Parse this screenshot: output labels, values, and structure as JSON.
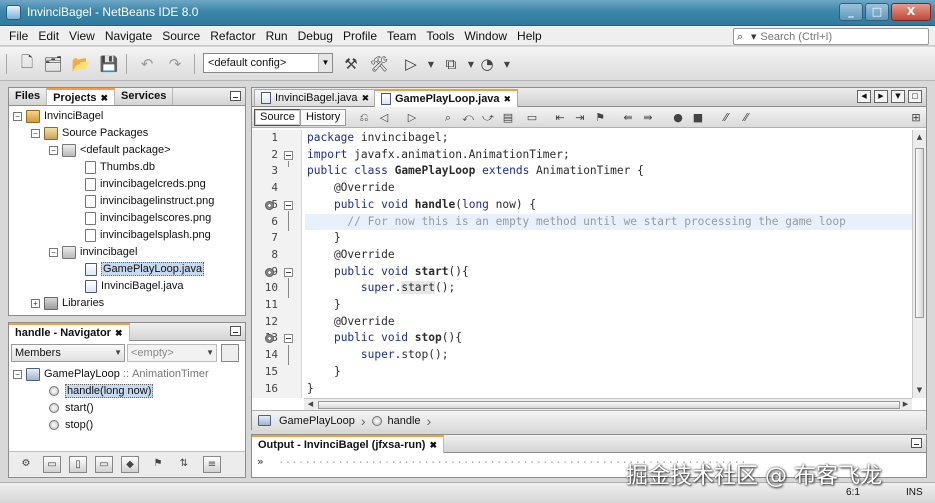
{
  "window": {
    "title": "InvinciBagel - NetBeans IDE 8.0",
    "minimize": "_",
    "maximize": "□",
    "close": "X"
  },
  "menu": [
    "File",
    "Edit",
    "View",
    "Navigate",
    "Source",
    "Refactor",
    "Run",
    "Debug",
    "Profile",
    "Team",
    "Tools",
    "Window",
    "Help"
  ],
  "search": {
    "placeholder": "Search (Ctrl+I)",
    "icon": "magnifier-icon"
  },
  "toolbar": {
    "config": "<default config>"
  },
  "projects_panel": {
    "tabs": [
      "Files",
      "Projects",
      "Services"
    ],
    "tree": [
      {
        "label": "InvinciBagel",
        "icon": "project-icon"
      },
      {
        "label": "Source Packages",
        "icon": "source-packages-icon"
      },
      {
        "label": "<default package>",
        "icon": "package-icon"
      },
      {
        "label": "Thumbs.db",
        "icon": "file-icon"
      },
      {
        "label": "invincibagelcreds.png",
        "icon": "image-file-icon"
      },
      {
        "label": "invincibagelinstruct.png",
        "icon": "image-file-icon"
      },
      {
        "label": "invincibagelscores.png",
        "icon": "image-file-icon"
      },
      {
        "label": "invincibagelsplash.png",
        "icon": "image-file-icon"
      },
      {
        "label": "invincibagel",
        "icon": "package-icon"
      },
      {
        "label": "GamePlayLoop.java",
        "icon": "java-file-icon"
      },
      {
        "label": "InvinciBagel.java",
        "icon": "java-file-icon"
      },
      {
        "label": "Libraries",
        "icon": "libraries-icon"
      }
    ]
  },
  "navigator": {
    "title": "handle - Navigator",
    "filter": "Members",
    "empty": "<empty>",
    "class_name": "GamePlayLoop",
    "class_sep": " :: ",
    "class_super": "AnimationTimer",
    "members": [
      "handle(long now)",
      "start()",
      "stop()"
    ]
  },
  "editor": {
    "tabs": [
      "InvinciBagel.java",
      "GamePlayLoop.java"
    ],
    "source_label": "Source",
    "history_label": "History",
    "lines": [
      {
        "n": "1",
        "html": "<span class=\"kw\">package</span> invincibagel;"
      },
      {
        "n": "2",
        "html": "<span class=\"kw\">import</span> javafx.animation.AnimationTimer;"
      },
      {
        "n": "3",
        "html": "<span class=\"kw\">public class</span> <span class=\"bold\">GamePlayLoop</span> <span class=\"kw\">extends</span> AnimationTimer {"
      },
      {
        "n": "4",
        "html": "    @Override"
      },
      {
        "n": "5",
        "html": "    <span class=\"kw\">public void</span> <span class=\"bold\">handle</span>(<span class=\"kw\">long</span> now) {"
      },
      {
        "n": "6",
        "html": "      <span class=\"cm\">// For now this is an empty method until we start processing the game loop</span>"
      },
      {
        "n": "7",
        "html": "    }"
      },
      {
        "n": "8",
        "html": "    @Override"
      },
      {
        "n": "9",
        "html": "    <span class=\"kw\">public void</span> <span class=\"bold\">start</span>(){"
      },
      {
        "n": "10",
        "html": "        <span class=\"kw\">super</span>.<span class=\"mark\">start</span>();"
      },
      {
        "n": "11",
        "html": "    }"
      },
      {
        "n": "12",
        "html": "    @Override"
      },
      {
        "n": "13",
        "html": "    <span class=\"kw\">public void</span> <span class=\"bold\">stop</span>(){"
      },
      {
        "n": "14",
        "html": "        <span class=\"kw\">super</span>.stop();"
      },
      {
        "n": "15",
        "html": "    }"
      },
      {
        "n": "16",
        "html": "}"
      }
    ],
    "breadcrumbs": [
      "GamePlayLoop",
      "handle"
    ]
  },
  "output": {
    "title": "Output - InvinciBagel (jfxsa-run)",
    "text": "......................................................................."
  },
  "status": {
    "position": "6:1",
    "mode": "INS"
  },
  "watermark": "掘金技术社区 @ 布客飞龙"
}
